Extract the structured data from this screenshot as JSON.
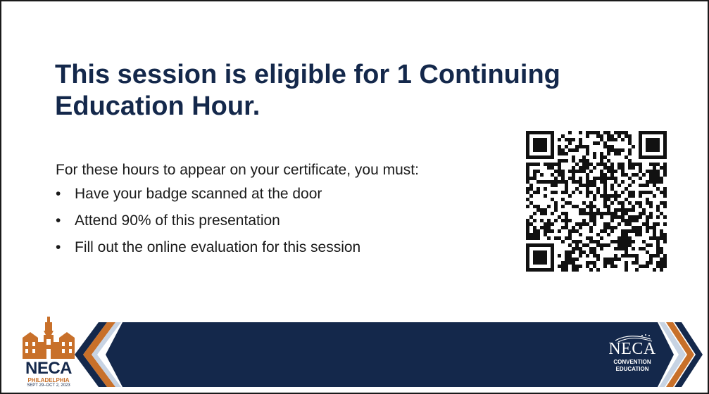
{
  "slide": {
    "title": "This session is eligible for 1 Continuing Education Hour.",
    "intro": "For these hours to appear on your certificate, you must:",
    "bullets": [
      "Have your badge scanned at the door",
      "Attend 90% of this presentation",
      "Fill out the online evaluation for this session"
    ],
    "bullet_glyph": "•"
  },
  "logo_left": {
    "name": "NECA",
    "city": "PHILADELPHIA",
    "dates": "SEPT 29–OCT 2, 2023"
  },
  "logo_right": {
    "name": "NECA",
    "line1": "CONVENTION",
    "line2": "EDUCATION"
  },
  "colors": {
    "navy": "#14284b",
    "orange": "#c8702a",
    "light_blue": "#c7d3e3",
    "text": "#1a1a1a"
  },
  "icons": {
    "qr": "qr-code",
    "left_logo_art": "city-hall-building-icon",
    "right_logo_art": "flag-stars-icon"
  }
}
